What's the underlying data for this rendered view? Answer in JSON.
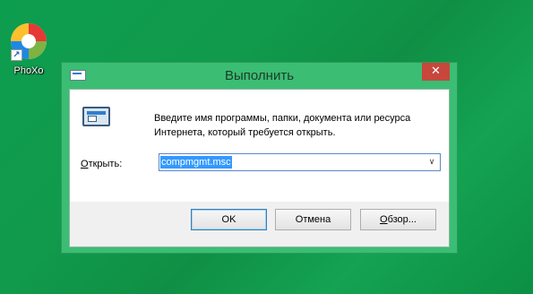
{
  "desktop": {
    "shortcut": {
      "label": "PhoXo",
      "icon": "phoxo-app-icon"
    }
  },
  "window": {
    "title": "Выполнить",
    "close_label": "✕",
    "description": "Введите имя программы, папки, документа или ресурса Интернета, который требуется открыть.",
    "open_label_underlined": "О",
    "open_label_rest": "ткрыть:",
    "input_value": "compmgmt.msc",
    "buttons": {
      "ok": "OK",
      "cancel": "Отмена",
      "browse_underlined": "О",
      "browse_rest": "бзор..."
    }
  },
  "colors": {
    "desktop_bg": "#119a4c",
    "window_frame": "#3bbd74",
    "close_button": "#c7473c",
    "selection": "#3399ff"
  }
}
